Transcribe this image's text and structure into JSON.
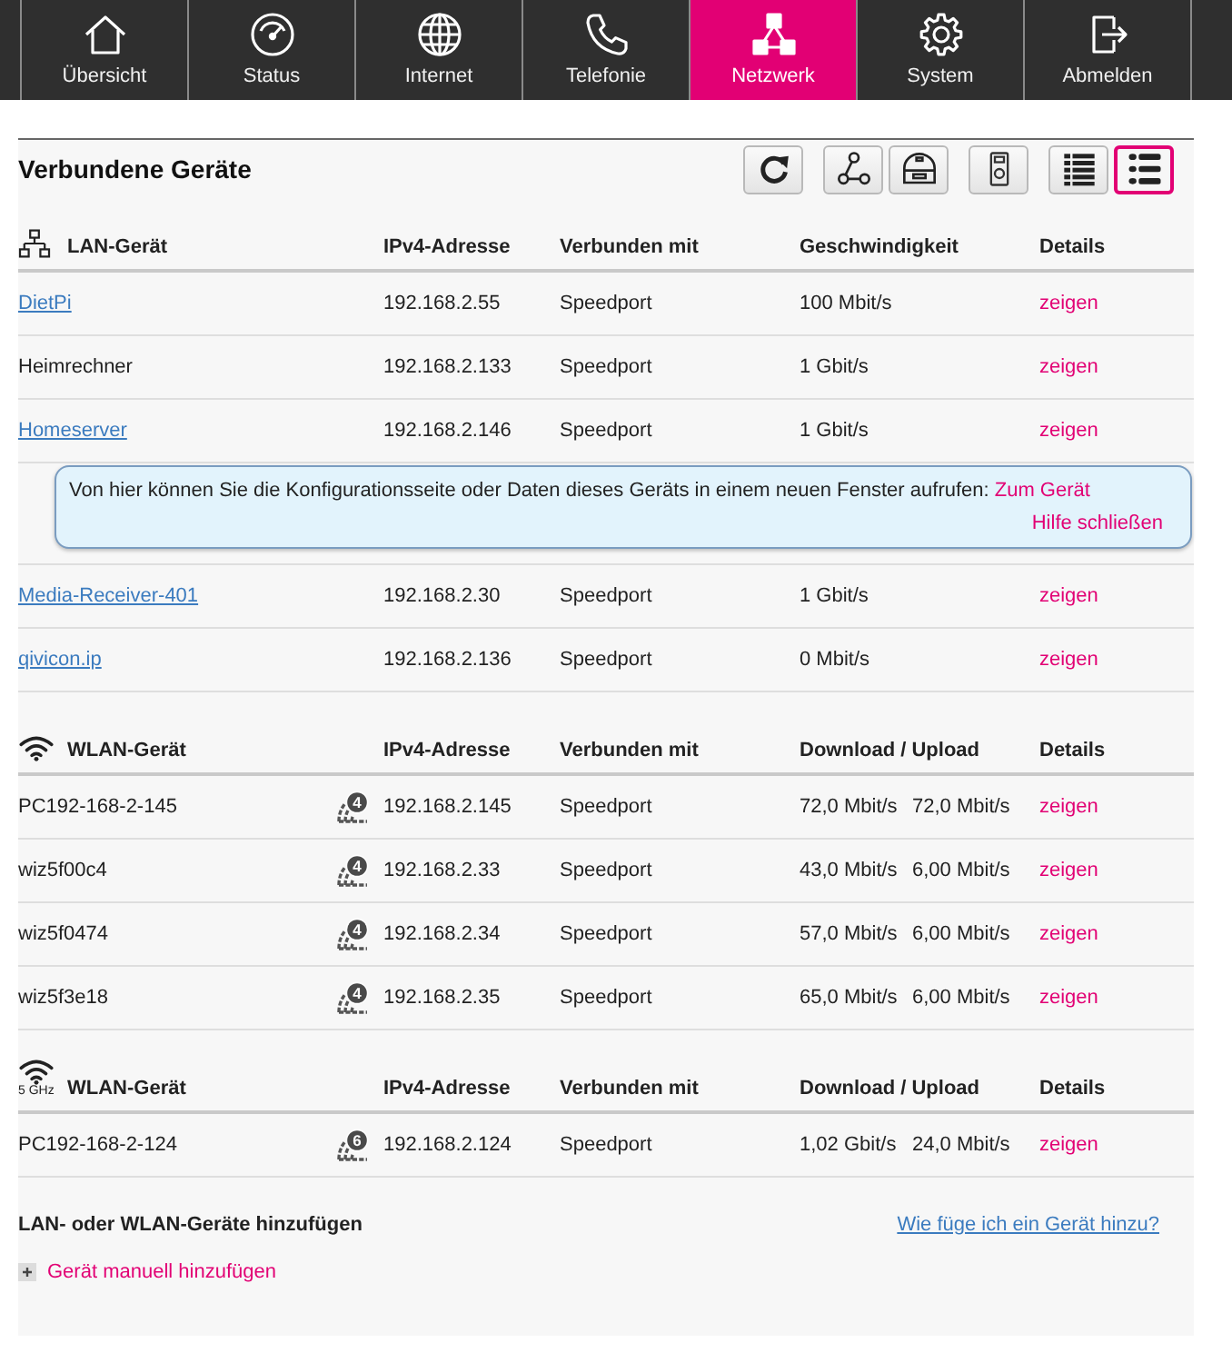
{
  "nav": [
    {
      "label": "Übersicht",
      "selected": false
    },
    {
      "label": "Status",
      "selected": false
    },
    {
      "label": "Internet",
      "selected": false
    },
    {
      "label": "Telefonie",
      "selected": false
    },
    {
      "label": "Netzwerk",
      "selected": true
    },
    {
      "label": "System",
      "selected": false
    },
    {
      "label": "Abmelden",
      "selected": false
    }
  ],
  "panel": {
    "title": "Verbundene Geräte",
    "toolbar_groups": [
      [
        {
          "selected": false
        }
      ],
      [
        {
          "selected": false
        },
        {
          "selected": false
        }
      ],
      [
        {
          "selected": false
        }
      ],
      [
        {
          "selected": false
        },
        {
          "selected": true
        }
      ]
    ]
  },
  "sections": [
    {
      "kind": "lan",
      "columns": [
        "LAN-Gerät",
        "IPv4-Adresse",
        "Verbunden mit",
        "Geschwindigkeit",
        "Details"
      ],
      "rows": [
        {
          "name": "DietPi",
          "linked": true,
          "ip": "192.168.2.55",
          "connected_to": "Speedport",
          "speed": "100 Mbit/s",
          "details": "zeigen"
        },
        {
          "name": "Heimrechner",
          "linked": false,
          "ip": "192.168.2.133",
          "connected_to": "Speedport",
          "speed": "1 Gbit/s",
          "details": "zeigen"
        },
        {
          "name": "Homeserver",
          "linked": true,
          "ip": "192.168.2.146",
          "connected_to": "Speedport",
          "speed": "1 Gbit/s",
          "details": "zeigen",
          "help": {
            "text": "Von hier können Sie die Konfigurationsseite oder Daten dieses Geräts in einem neuen Fenster aufrufen:",
            "link": "Zum Gerät",
            "close": "Hilfe schließen"
          }
        },
        {
          "name": "Media-Receiver-401",
          "linked": true,
          "ip": "192.168.2.30",
          "connected_to": "Speedport",
          "speed": "1 Gbit/s",
          "details": "zeigen"
        },
        {
          "name": "qivicon.ip",
          "linked": true,
          "ip": "192.168.2.136",
          "connected_to": "Speedport",
          "speed": "0 Mbit/s",
          "details": "zeigen"
        }
      ]
    },
    {
      "kind": "wlan",
      "columns": [
        "WLAN-Gerät",
        "IPv4-Adresse",
        "Verbunden mit",
        "Download / Upload",
        "Details"
      ],
      "rows": [
        {
          "name": "PC192-168-2-145",
          "linked": false,
          "wifi_standard": "4",
          "ip": "192.168.2.145",
          "connected_to": "Speedport",
          "download": "72,0 Mbit/s",
          "upload": "72,0 Mbit/s",
          "details": "zeigen"
        },
        {
          "name": "wiz5f00c4",
          "linked": false,
          "wifi_standard": "4",
          "ip": "192.168.2.33",
          "connected_to": "Speedport",
          "download": "43,0 Mbit/s",
          "upload": "6,00 Mbit/s",
          "details": "zeigen"
        },
        {
          "name": "wiz5f0474",
          "linked": false,
          "wifi_standard": "4",
          "ip": "192.168.2.34",
          "connected_to": "Speedport",
          "download": "57,0 Mbit/s",
          "upload": "6,00 Mbit/s",
          "details": "zeigen"
        },
        {
          "name": "wiz5f3e18",
          "linked": false,
          "wifi_standard": "4",
          "ip": "192.168.2.35",
          "connected_to": "Speedport",
          "download": "65,0 Mbit/s",
          "upload": "6,00 Mbit/s",
          "details": "zeigen"
        }
      ]
    },
    {
      "kind": "wlan",
      "band": "5 GHz",
      "columns": [
        "WLAN-Gerät",
        "IPv4-Adresse",
        "Verbunden mit",
        "Download / Upload",
        "Details"
      ],
      "rows": [
        {
          "name": "PC192-168-2-124",
          "linked": false,
          "wifi_standard": "6",
          "ip": "192.168.2.124",
          "connected_to": "Speedport",
          "download": "1,02 Gbit/s",
          "upload": "24,0 Mbit/s",
          "details": "zeigen"
        }
      ]
    }
  ],
  "add_devices": {
    "title": "LAN- oder WLAN-Geräte hinzufügen",
    "help_link": "Wie füge ich ein Gerät hinzu?",
    "action": "Gerät manuell hinzufügen"
  }
}
